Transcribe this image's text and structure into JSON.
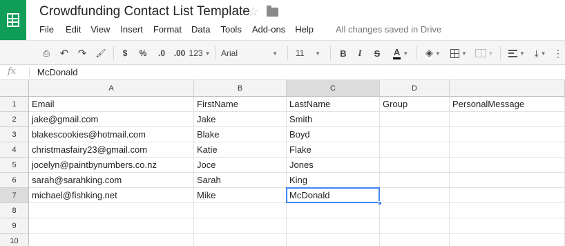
{
  "app": {
    "title": "Crowdfunding Contact List Template",
    "save_status": "All changes saved in Drive",
    "accent": "#0f9d58",
    "selection_color": "#4285f4"
  },
  "menu": [
    "File",
    "Edit",
    "View",
    "Insert",
    "Format",
    "Data",
    "Tools",
    "Add-ons",
    "Help"
  ],
  "toolbar": {
    "currency": "$",
    "percent": "%",
    "decrease_decimals": ".0",
    "increase_decimals": ".00",
    "more_formats": "123",
    "font": "Arial",
    "font_size": "11",
    "bold": "B",
    "italic": "I",
    "strikethrough": "S",
    "text_color": "A"
  },
  "formula_bar": {
    "fx": "fx",
    "value": "McDonald"
  },
  "sheet": {
    "columns": [
      "A",
      "B",
      "C",
      "D",
      "E"
    ],
    "row_numbers": [
      "1",
      "2",
      "3",
      "4",
      "5",
      "6",
      "7",
      "8",
      "9",
      "10"
    ],
    "selected_cell": "C7",
    "rows": [
      [
        "Email",
        "FirstName",
        "LastName",
        "Group",
        "PersonalMessage"
      ],
      [
        "jake@gmail.com",
        "Jake",
        "Smith",
        "",
        ""
      ],
      [
        "blakescookies@hotmail.com",
        "Blake",
        "Boyd",
        "",
        ""
      ],
      [
        "christmasfairy23@gmail.com",
        "Katie",
        "Flake",
        "",
        ""
      ],
      [
        "jocelyn@paintbynumbers.co.nz",
        "Joce",
        "Jones",
        "",
        ""
      ],
      [
        "sarah@sarahking.com",
        "Sarah",
        "King",
        "",
        ""
      ],
      [
        "michael@fishking.net",
        "Mike",
        "McDonald",
        "",
        ""
      ],
      [
        "",
        "",
        "",
        "",
        ""
      ],
      [
        "",
        "",
        "",
        "",
        ""
      ],
      [
        "",
        "",
        "",
        "",
        ""
      ]
    ]
  }
}
